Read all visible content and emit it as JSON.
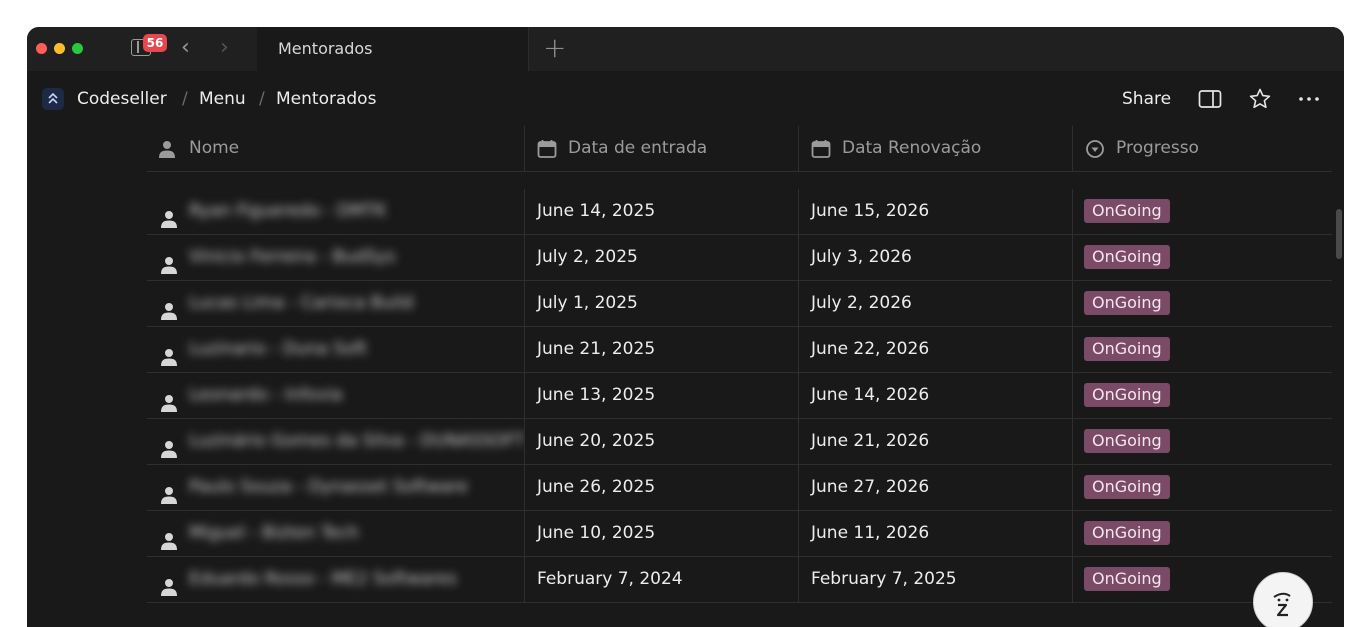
{
  "tabbar": {
    "notification_count": "56",
    "tab_title": "Mentorados",
    "new_tab_symbol": "+"
  },
  "breadcrumb": {
    "workspace": "Codeseller",
    "separator": "/",
    "menu": "Menu",
    "page": "Mentorados"
  },
  "header": {
    "share_label": "Share"
  },
  "table": {
    "columns": {
      "name": "Nome",
      "entry": "Data de entrada",
      "renewal": "Data Renovação",
      "progress": "Progresso"
    },
    "rows": [
      {
        "name": "Ryan Figueredo - DMTK",
        "entry": "June 14, 2025",
        "renewal": "June 15, 2026",
        "progress": "OnGoing"
      },
      {
        "name": "Vinicio Ferreira - BudSys",
        "entry": "July 2, 2025",
        "renewal": "July 3, 2026",
        "progress": "OnGoing"
      },
      {
        "name": "Lucas Lima - Carioca Build",
        "entry": "July 1, 2025",
        "renewal": "July 2, 2026",
        "progress": "OnGoing"
      },
      {
        "name": "Luzinario - Duna Soft",
        "entry": "June 21, 2025",
        "renewal": "June 22, 2026",
        "progress": "OnGoing"
      },
      {
        "name": "Leonardo - Infovia",
        "entry": "June 13, 2025",
        "renewal": "June 14, 2026",
        "progress": "OnGoing"
      },
      {
        "name": "Luzinário Gomes da Silva - DUNASSOFT",
        "entry": "June 20, 2025",
        "renewal": "June 21, 2026",
        "progress": "OnGoing"
      },
      {
        "name": "Paulo Souza - Dynasset Software",
        "entry": "June 26, 2025",
        "renewal": "June 27, 2026",
        "progress": "OnGoing"
      },
      {
        "name": "Miguel - Bizten Tech",
        "entry": "June 10, 2025",
        "renewal": "June 11, 2026",
        "progress": "OnGoing"
      },
      {
        "name": "Eduardo Rosso - ME2 Softwares",
        "entry": "February 7, 2024",
        "renewal": "February 7, 2025",
        "progress": "OnGoing"
      }
    ]
  },
  "colors": {
    "window_bg": "#191919",
    "tag_bg": "#7a4a66",
    "badge_bg": "#e5484d"
  },
  "icons": {
    "sidebar": "sidebar-toggle-icon",
    "back": "chevron-left-icon",
    "forward": "chevron-right-icon",
    "person": "person-icon",
    "calendar": "calendar-icon",
    "status": "status-icon",
    "panel": "side-panel-icon",
    "star": "star-icon",
    "more": "more-icon",
    "help": "help-avatar-icon"
  }
}
